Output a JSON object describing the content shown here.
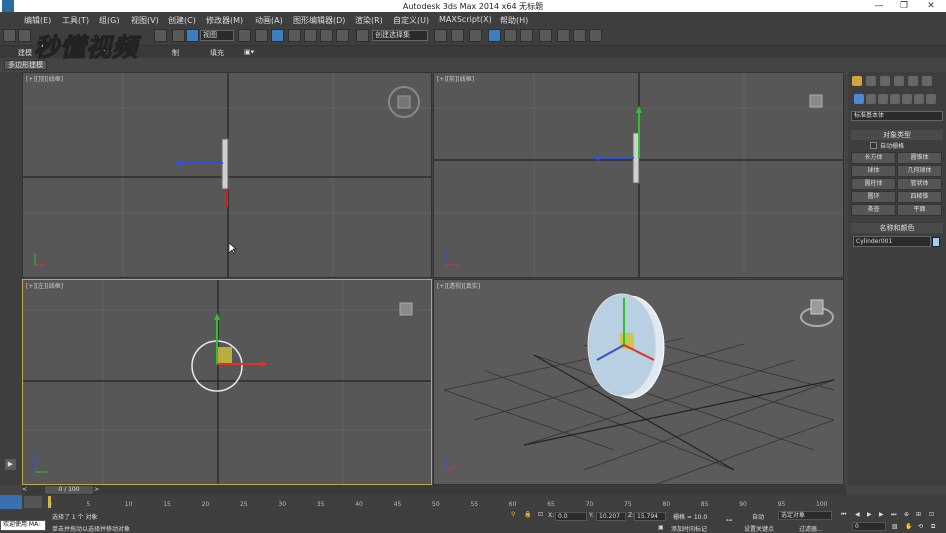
{
  "app": {
    "title": "Autodesk 3ds Max  2014 x64      无标题"
  },
  "menu": [
    "编辑(E)",
    "工具(T)",
    "组(G)",
    "视图(V)",
    "创建(C)",
    "修改器(M)",
    "动画(A)",
    "图形编辑器(D)",
    "渲染(R)",
    "自定义(U)",
    "MAXScript(X)",
    "帮助(H)"
  ],
  "toolbar": {
    "view_dropdown": "视图",
    "selection_set": "创建选择集"
  },
  "ribbon": {
    "tab_model": "建模",
    "tab_fill": "填充",
    "tab_partial": "制"
  },
  "polygon_tab": "多边形建模",
  "watermark": "秒懂视频",
  "viewports": {
    "top": "[+][顶][线框]",
    "front": "[+][前][线框]",
    "left": "[+][左][线框]",
    "perspective": "[+][透视][真实]"
  },
  "command_panel": {
    "category_dropdown": "标准基本体",
    "section_object_type": "对象类型",
    "autogrid": "自动栅格",
    "buttons": [
      "长方体",
      "圆锥体",
      "球体",
      "几何球体",
      "圆柱体",
      "管状体",
      "圆环",
      "四棱锥",
      "茶壶",
      "平面"
    ],
    "section_name_color": "名称和颜色",
    "object_name": "Cylinder001",
    "object_color": "#9ed0f0"
  },
  "timeline": {
    "frame": "0 / 100",
    "ticks": [
      "0",
      "5",
      "10",
      "15",
      "20",
      "25",
      "30",
      "35",
      "40",
      "45",
      "50",
      "55",
      "60",
      "65",
      "70",
      "75",
      "80",
      "85",
      "90",
      "95",
      "100"
    ]
  },
  "status": {
    "welcome": "欢迎使用 MA:",
    "selected": "选择了 1 个 对象",
    "hint": "单击并拖动以选择并移动对象",
    "x_label": "X:",
    "x_value": "0.0",
    "y_label": "Y:",
    "y_value": "10.207",
    "z_label": "Z:",
    "z_value": "15.794",
    "grid": "栅格 = 10.0",
    "add_tag": "添加时间标记",
    "auto_key": "自动",
    "set_key": "设置关键点",
    "selected_object": "选定对象",
    "filters": "过滤器...",
    "frame_value": "0"
  },
  "colors": {
    "axis_x": "#e03030",
    "axis_y": "#30c030",
    "axis_z": "#3050e0",
    "active_border": "#bfa74d"
  }
}
